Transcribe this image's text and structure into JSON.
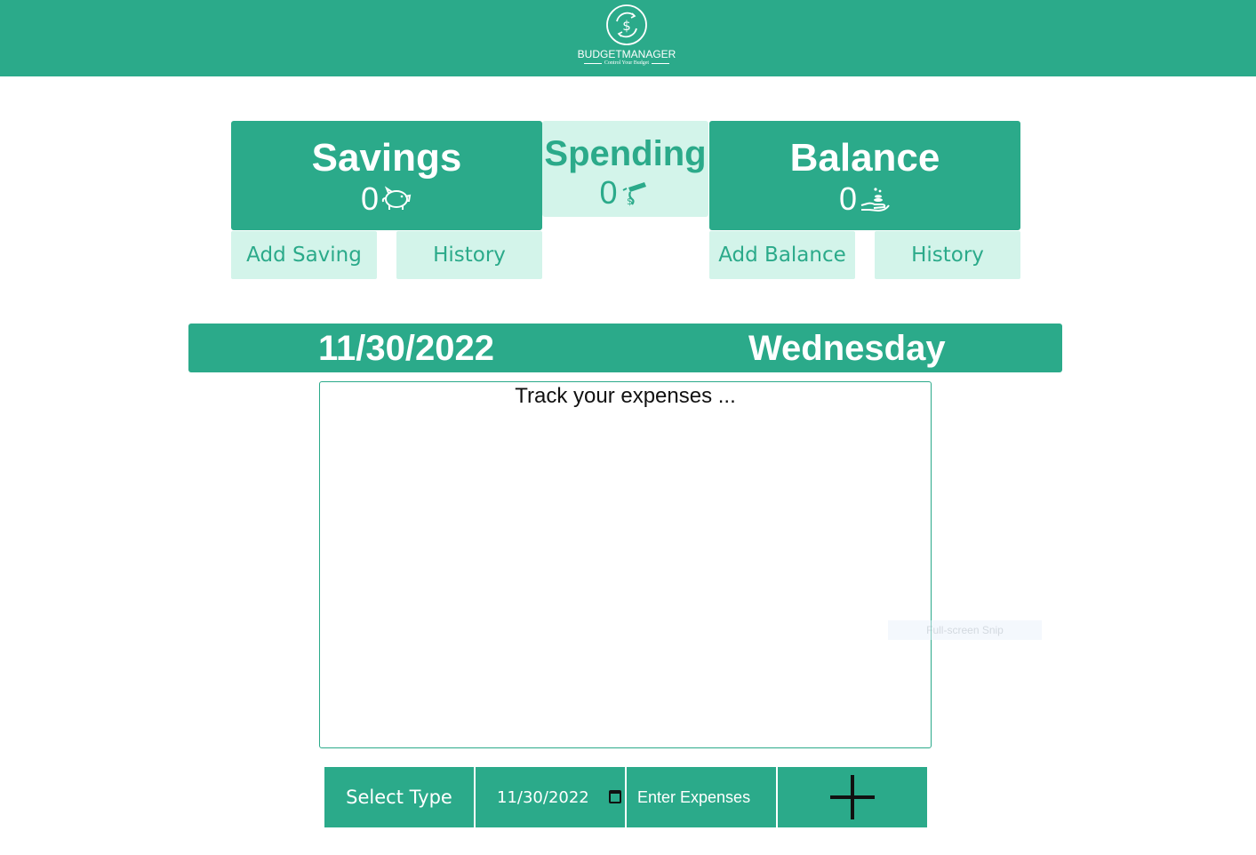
{
  "header": {
    "brand": "BUDGETMANAGER",
    "tagline": "Control Your Budget",
    "logo_icon": "dollar-circle-icon"
  },
  "summary": {
    "savings": {
      "title": "Savings",
      "value": "0",
      "icon": "piggy-bank-icon"
    },
    "spending": {
      "title": "Spending",
      "value": "0",
      "icon": "money-flying-icon"
    },
    "balance": {
      "title": "Balance",
      "value": "0",
      "icon": "hand-coins-icon"
    }
  },
  "actions": {
    "add_saving": "Add Saving",
    "savings_history": "History",
    "add_balance": "Add Balance",
    "balance_history": "History"
  },
  "date_bar": {
    "date": "11/30/2022",
    "weekday": "Wednesday"
  },
  "expenses": {
    "title": "Track your expenses ..."
  },
  "overlay": {
    "snip_label": "Full-screen Snip"
  },
  "form": {
    "type_select": "Select Type",
    "date_value": "11/30/2022",
    "amount_placeholder": "Enter Expenses",
    "add_icon": "plus-icon"
  },
  "colors": {
    "primary": "#2baa8a",
    "light": "#d3f4ea",
    "white": "#ffffff"
  }
}
